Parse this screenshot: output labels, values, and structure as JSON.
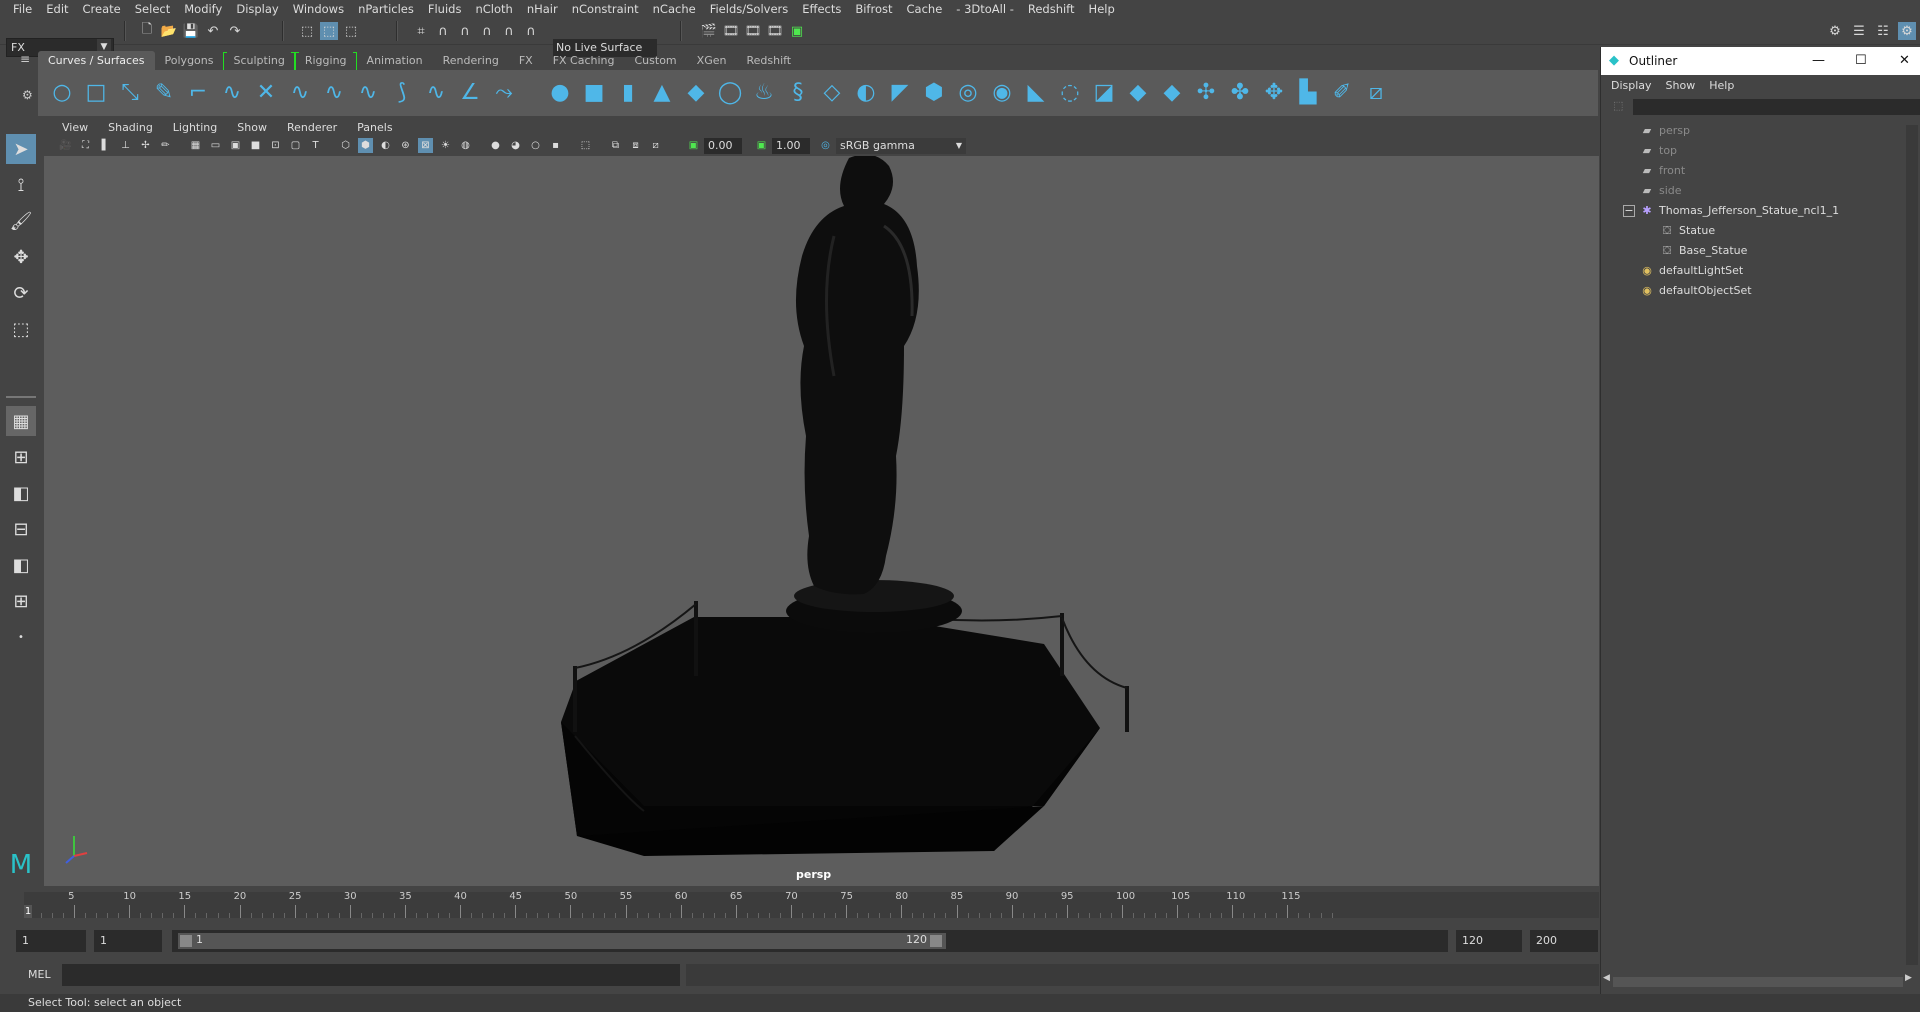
{
  "menubar": [
    "File",
    "Edit",
    "Create",
    "Select",
    "Modify",
    "Display",
    "Windows",
    "nParticles",
    "Fluids",
    "nCloth",
    "nHair",
    "nConstraint",
    "nCache",
    "Fields/Solvers",
    "Effects",
    "Bifrost",
    "Cache",
    "- 3DtoAll -",
    "Redshift",
    "Help"
  ],
  "status": {
    "menu_set": "FX",
    "live_surface": "No Live Surface"
  },
  "shelf_tabs": [
    "Curves / Surfaces",
    "Polygons",
    "Sculpting",
    "Rigging",
    "Animation",
    "Rendering",
    "FX",
    "FX Caching",
    "Custom",
    "XGen",
    "Redshift"
  ],
  "viewport_menu": [
    "View",
    "Shading",
    "Lighting",
    "Show",
    "Renderer",
    "Panels"
  ],
  "panel": {
    "exposure": "0.00",
    "gamma": "1.00",
    "color_space": "sRGB gamma"
  },
  "viewport": {
    "camera_label": "persp",
    "bg": "#5d5d5d"
  },
  "timeline": {
    "ticks": [
      "5",
      "10",
      "15",
      "20",
      "25",
      "30",
      "35",
      "40",
      "45",
      "50",
      "55",
      "60",
      "65",
      "70",
      "75",
      "80",
      "85",
      "90",
      "95",
      "100",
      "105",
      "110",
      "115"
    ],
    "current_frame": "1"
  },
  "range": {
    "start": "1",
    "playback_start": "1",
    "slider_start": "1",
    "slider_end": "120",
    "playback_end": "120",
    "end": "200"
  },
  "cmd": {
    "lang": "MEL"
  },
  "helpline": "Select Tool: select an object",
  "outliner": {
    "title": "Outliner",
    "menu": [
      "Display",
      "Show",
      "Help"
    ],
    "items": [
      {
        "label": "persp",
        "icon": "camera-icon",
        "dim": true
      },
      {
        "label": "top",
        "icon": "camera-icon",
        "dim": true
      },
      {
        "label": "front",
        "icon": "camera-icon",
        "dim": true
      },
      {
        "label": "side",
        "icon": "camera-icon",
        "dim": true
      },
      {
        "label": "Thomas_Jefferson_Statue_ncl1_1",
        "icon": "group-icon",
        "dim": false
      },
      {
        "label": "Statue",
        "icon": "mesh-icon",
        "dim": false
      },
      {
        "label": "Base_Statue",
        "icon": "mesh-icon",
        "dim": false
      },
      {
        "label": "defaultLightSet",
        "icon": "set-icon",
        "dim": false
      },
      {
        "label": "defaultObjectSet",
        "icon": "set-icon",
        "dim": false
      }
    ]
  },
  "colors": {
    "accent": "#4fb7e8",
    "panel": "#444444",
    "dark": "#2b2b2b",
    "viewport": "#5d5d5d"
  }
}
